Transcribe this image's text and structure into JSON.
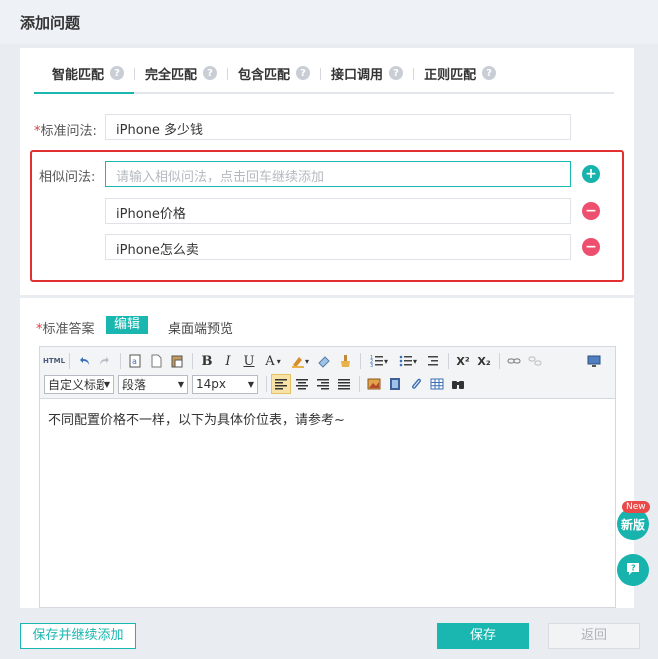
{
  "dialog": {
    "title": "添加问题"
  },
  "tabs": [
    {
      "label": "智能匹配",
      "active": true
    },
    {
      "label": "完全匹配",
      "active": false
    },
    {
      "label": "包含匹配",
      "active": false
    },
    {
      "label": "接口调用",
      "active": false
    },
    {
      "label": "正则匹配",
      "active": false
    }
  ],
  "standard_question": {
    "required_mark": "*",
    "label": "标准问法:",
    "value": "iPhone 多少钱"
  },
  "similar_questions": {
    "label": "相似问法:",
    "placeholder": "请输入相似问法，点击回车继续添加",
    "items": [
      "iPhone价格",
      "iPhone怎么卖"
    ],
    "add_symbol": "+",
    "remove_symbol": "−"
  },
  "answer": {
    "required_mark": "*",
    "label": "标准答案",
    "edit_badge": "编辑",
    "preview_label": "桌面端预览",
    "content": "不同配置价格不一样，以下为具体价位表，请参考~"
  },
  "editor_toolbar": {
    "html_label": "HTML",
    "bold": "B",
    "italic": "I",
    "underline": "U",
    "font_color": "A",
    "superscript": "X²",
    "subscript": "X₂",
    "heading_select": "自定义标题",
    "paragraph_select": "段落",
    "size_select": "14px"
  },
  "floating": {
    "new_badge": "New",
    "new_version_label": "新版",
    "help_icon": "question-icon"
  },
  "footer": {
    "save_continue": "保存并继续添加",
    "save": "保存",
    "back": "返回"
  },
  "colors": {
    "accent": "#19b7b0",
    "highlight_border": "#e23030",
    "remove": "#ee4f6f"
  }
}
